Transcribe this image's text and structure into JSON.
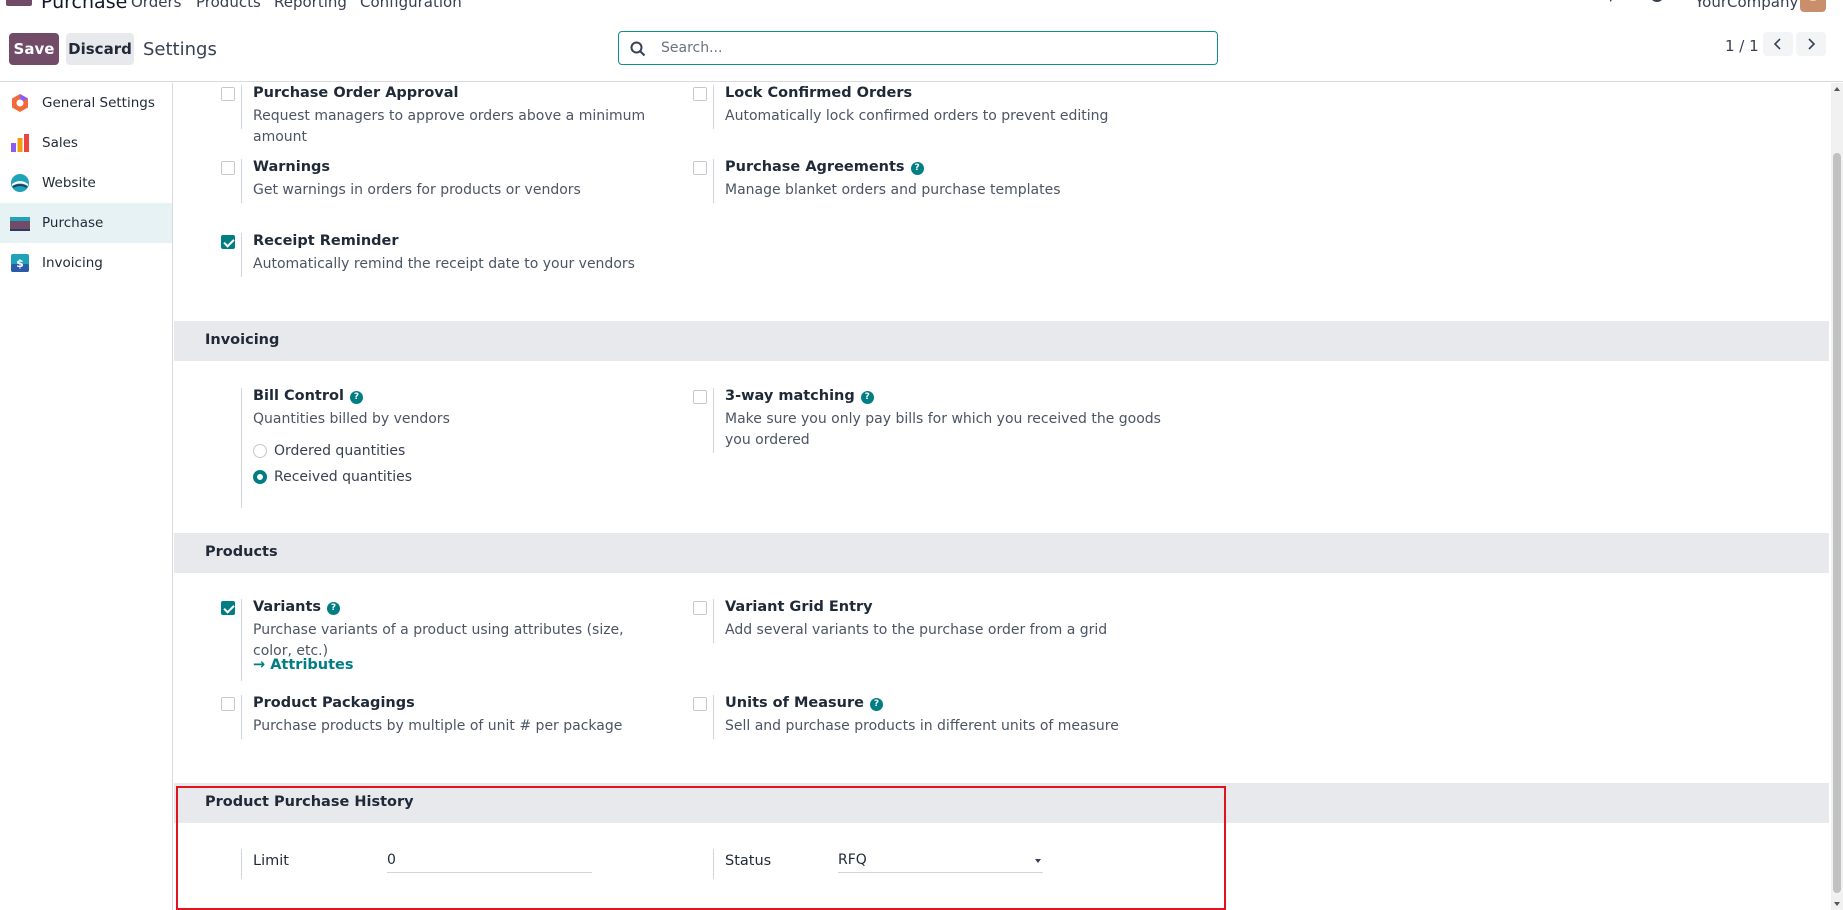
{
  "navbar": {
    "app_name": "Purchase",
    "menus": [
      "Orders",
      "Products",
      "Reporting",
      "Configuration"
    ],
    "company": "YourCompany"
  },
  "control_panel": {
    "save_label": "Save",
    "discard_label": "Discard",
    "title": "Settings",
    "search_placeholder": "Search...",
    "pager": "1 / 1"
  },
  "sidebar": {
    "items": [
      {
        "label": "General Settings",
        "icon": "general-settings-icon",
        "active": false
      },
      {
        "label": "Sales",
        "icon": "sales-icon",
        "active": false
      },
      {
        "label": "Website",
        "icon": "website-icon",
        "active": false
      },
      {
        "label": "Purchase",
        "icon": "purchase-icon",
        "active": true
      },
      {
        "label": "Invoicing",
        "icon": "invoicing-icon",
        "active": false
      }
    ]
  },
  "orders_section": {
    "settings": [
      {
        "title": "Purchase Order Approval",
        "desc": "Request managers to approve orders above a minimum amount",
        "checked": false
      },
      {
        "title": "Lock Confirmed Orders",
        "desc": "Automatically lock confirmed orders to prevent editing",
        "checked": false
      },
      {
        "title": "Warnings",
        "desc": "Get warnings in orders for products or vendors",
        "checked": false
      },
      {
        "title": "Purchase Agreements",
        "desc": "Manage blanket orders and purchase templates",
        "checked": false
      },
      {
        "title": "Receipt Reminder",
        "desc": "Automatically remind the receipt date to your vendors",
        "checked": true
      }
    ]
  },
  "invoicing_section": {
    "title": "Invoicing",
    "bill_control": {
      "title": "Bill Control",
      "desc": "Quantities billed by vendors",
      "options": [
        "Ordered quantities",
        "Received quantities"
      ],
      "selected": "Received quantities"
    },
    "three_way": {
      "title": "3-way matching",
      "desc_line1": "Make sure you only pay bills for which you received the goods",
      "desc_line2": "you ordered",
      "checked": false
    }
  },
  "products_section": {
    "title": "Products",
    "variants": {
      "title": "Variants",
      "desc": "Purchase variants of a product using attributes (size, color, etc.)",
      "checked": true,
      "link": "Attributes"
    },
    "variant_grid": {
      "title": "Variant Grid Entry",
      "desc": "Add several variants to the purchase order from a grid",
      "checked": false
    },
    "packagings": {
      "title": "Product Packagings",
      "desc": "Purchase products by multiple of unit # per package",
      "checked": false
    },
    "uom": {
      "title": "Units of Measure",
      "desc": "Sell and purchase products in different units of measure",
      "checked": false
    }
  },
  "history_section": {
    "title": "Product Purchase History",
    "limit_label": "Limit",
    "limit_value": "0",
    "status_label": "Status",
    "status_value": "RFQ"
  },
  "colors": {
    "brand": "#714b67",
    "accent": "#017e84",
    "highlight": "#e0141e"
  }
}
